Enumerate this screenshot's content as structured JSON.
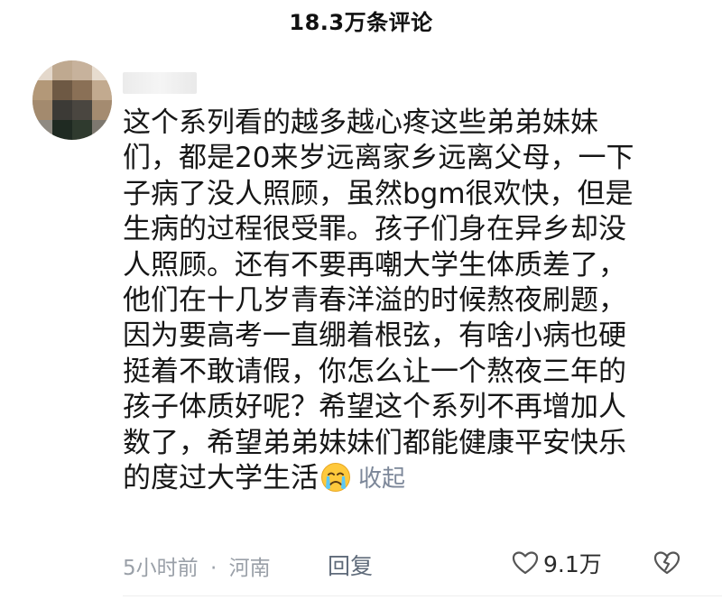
{
  "header": {
    "title": "18.3万条评论"
  },
  "comment": {
    "lines": [
      "这个系列看的越多越心疼这些弟弟妹妹",
      "们，都是20来岁远离家乡远离父母，一下",
      "子病了没人照顾，虽然bgm很欢快，但是",
      "生病的过程很受罪。孩子们身在异乡却没",
      "人照顾。还有不要再嘲大学生体质差了，",
      "他们在十几岁青春洋溢的时候熬夜刷题，",
      "因为要高考一直绷着根弦，有啥小病也硬",
      "挺着不敢请假，你怎么让一个熬夜三年的",
      "孩子体质好呢？希望这个系列不再增加人",
      "数了，希望弟弟妹妹们都能健康平安快乐",
      "的度过大学生活"
    ],
    "emoji": "crying-face-icon",
    "collapse_label": "收起"
  },
  "meta": {
    "time": "5小时前",
    "separator": "·",
    "location": "河南",
    "reply_label": "回复",
    "like_count": "9.1万"
  },
  "colors": {
    "text": "#161616",
    "secondary": "#9aa0a8",
    "link": "#7c8799"
  }
}
